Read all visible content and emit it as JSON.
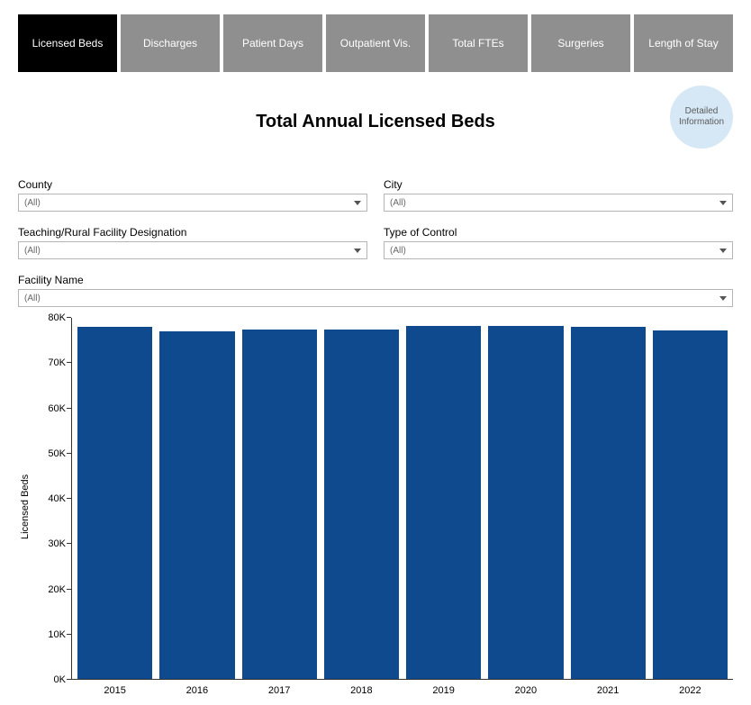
{
  "tabs": [
    {
      "label": "Licensed Beds",
      "active": true
    },
    {
      "label": "Discharges",
      "active": false
    },
    {
      "label": "Patient Days",
      "active": false
    },
    {
      "label": "Outpatient Vis.",
      "active": false
    },
    {
      "label": "Total FTEs",
      "active": false
    },
    {
      "label": "Surgeries",
      "active": false
    },
    {
      "label": "Length of Stay",
      "active": false
    }
  ],
  "title": "Total Annual Licensed Beds",
  "detail_badge": "Detailed Information",
  "filters": {
    "county": {
      "label": "County",
      "value": "(All)"
    },
    "city": {
      "label": "City",
      "value": "(All)"
    },
    "teaching": {
      "label": "Teaching/Rural Facility Designation",
      "value": "(All)"
    },
    "control": {
      "label": "Type of Control",
      "value": "(All)"
    },
    "facility": {
      "label": "Facility Name",
      "value": "(All)"
    }
  },
  "chart_data": {
    "type": "bar",
    "categories": [
      "2015",
      "2016",
      "2017",
      "2018",
      "2019",
      "2020",
      "2021",
      "2022"
    ],
    "values": [
      78000,
      77000,
      77500,
      77500,
      78200,
      78300,
      78000,
      77200
    ],
    "title": "Total Annual Licensed Beds",
    "xlabel": "",
    "ylabel": "Licensed Beds",
    "ylim": [
      0,
      80000
    ],
    "yticks": [
      0,
      10000,
      20000,
      30000,
      40000,
      50000,
      60000,
      70000,
      80000
    ],
    "ytick_labels": [
      "0K",
      "10K",
      "20K",
      "30K",
      "40K",
      "50K",
      "60K",
      "70K",
      "80K"
    ],
    "bar_color": "#0f4a8f"
  }
}
